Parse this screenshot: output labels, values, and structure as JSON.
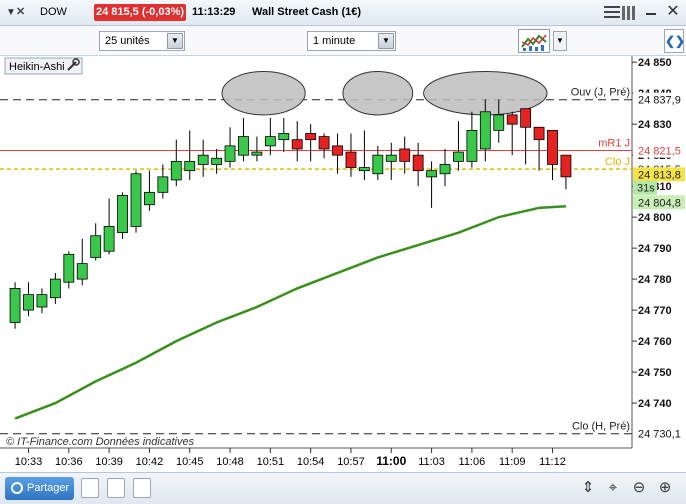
{
  "titlebar": {
    "symbol": "DOW",
    "price_change": "24 815,5 (-0,03%)",
    "time": "11:13:29",
    "instrument": "Wall Street Cash (1€)"
  },
  "toolbar": {
    "units_select": "25 unités",
    "period_select": "1 minute"
  },
  "footer": {
    "share_label": "Partager"
  },
  "colors": {
    "bull": "#3ac84a",
    "bear": "#e52222",
    "ma": "#3a8f1e",
    "mr1_line": "#e04040",
    "clo_line": "#d4c000"
  },
  "chart_data": {
    "type": "candlestick",
    "chart_style_label": "Heikin-Ashi",
    "watermark": "© IT-Finance.com  Données indicatives",
    "ylim": [
      24725.5,
      24852
    ],
    "x_tick_labels": [
      "10:33",
      "10:36",
      "10:39",
      "10:42",
      "10:45",
      "10:48",
      "10:51",
      "10:54",
      "10:57",
      "11:00",
      "11:03",
      "11:06",
      "11:09",
      "11:12"
    ],
    "x_tick_minutes": [
      633,
      636,
      639,
      642,
      645,
      648,
      651,
      654,
      657,
      660,
      663,
      666,
      669,
      672
    ],
    "y_ticks": [
      24740,
      24750,
      24760,
      24770,
      24780,
      24790,
      24800,
      24810,
      24820,
      24830,
      24840,
      24850
    ],
    "y_tick_labels": [
      "24 740",
      "24 750",
      "24 760",
      "24 770",
      "24 780",
      "24 790",
      "24 800",
      "24 810",
      "24 820",
      "24 830",
      "24 840",
      "24 850"
    ],
    "series": [
      {
        "name": "Heikin-Ashi",
        "time_minutes": [
          632,
          633,
          634,
          635,
          636,
          637,
          638,
          639,
          640,
          641,
          642,
          643,
          644,
          645,
          646,
          647,
          648,
          649,
          650,
          651,
          652,
          653,
          654,
          655,
          656,
          657,
          658,
          659,
          660,
          661,
          662,
          663,
          664,
          665,
          666,
          667,
          668,
          669,
          670,
          671,
          672,
          673
        ],
        "open": [
          24766,
          24770,
          24771,
          24774,
          24779,
          24780,
          24787,
          24789,
          24795,
          24797,
          24804,
          24808,
          24812,
          24815,
          24817,
          24817,
          24818,
          24820,
          24820,
          24823,
          24825,
          24825,
          24827,
          24826,
          24823,
          24821,
          24815,
          24814,
          24818,
          24822,
          24820,
          24813,
          24814,
          24818,
          24818,
          24822,
          24828,
          24833,
          24835,
          24829,
          24828,
          24820
        ],
        "close": [
          24777,
          24775,
          24775,
          24780,
          24788,
          24785,
          24794,
          24797,
          24807,
          24814,
          24808,
          24813,
          24818,
          24818,
          24820,
          24819,
          24823,
          24826,
          24821,
          24826,
          24827,
          24822,
          24825,
          24822,
          24820,
          24816,
          24816,
          24820,
          24820,
          24818,
          24815,
          24815,
          24817,
          24821,
          24828,
          24834,
          24833,
          24830,
          24829,
          24825,
          24817,
          24813
        ],
        "high": [
          24779,
          24779,
          24777,
          24782,
          24789,
          24793,
          24798,
          24806,
          24808,
          24815,
          24815,
          24817,
          24825,
          24828,
          24825,
          24822,
          24829,
          24832,
          24826,
          24832,
          24832,
          24831,
          24830,
          24827,
          24827,
          24827,
          24828,
          24823,
          24824,
          24826,
          24824,
          24818,
          24822,
          24831,
          24834,
          24838,
          24838,
          24834,
          24832,
          24828,
          24827,
          24817
        ],
        "low": [
          24764,
          24768,
          24769,
          24772,
          24777,
          24778,
          24786,
          24788,
          24793,
          24795,
          24802,
          24806,
          24810,
          24812,
          24813,
          24814,
          24816,
          24818,
          24818,
          24820,
          24821,
          24818,
          24818,
          24819,
          24814,
          24813,
          24812,
          24812,
          24812,
          24814,
          24810,
          24803,
          24810,
          24815,
          24816,
          24818,
          24824,
          24820,
          24817,
          24815,
          24812,
          24809
        ]
      },
      {
        "name": "moving average",
        "time_minutes": [
          632,
          635,
          638,
          641,
          644,
          647,
          650,
          653,
          656,
          659,
          662,
          665,
          668,
          671,
          673
        ],
        "values": [
          24735,
          24740,
          24747,
          24753,
          24760,
          24766,
          24771,
          24777,
          24782,
          24787,
          24791,
          24795,
          24800,
          24803,
          24803.5
        ]
      }
    ],
    "annotations": [
      {
        "id": "ouv",
        "label": "Ouv (J, Pré)",
        "value": 24837.9,
        "value_label": "24 837,9",
        "style": "dashed-black"
      },
      {
        "id": "mr1",
        "label": "mR1 J",
        "value": 24821.5,
        "value_label": "24 821,5",
        "style": "solid-red"
      },
      {
        "id": "clo",
        "label": "Clo J",
        "value": 24815.5,
        "value_label": "24 815,5",
        "style": "dashed-yellow"
      },
      {
        "id": "last",
        "label": "",
        "value": 24813.8,
        "value_label": "24 813,8",
        "style": "marker-yellow"
      },
      {
        "id": "countdown",
        "label": "31s",
        "value": 24809.5,
        "value_label": "",
        "style": "marker-green"
      },
      {
        "id": "ma_last",
        "label": "",
        "value": 24804.8,
        "value_label": "24 804,8",
        "style": "marker-green"
      },
      {
        "id": "cloH",
        "label": "Clo (H, Pré)",
        "value": 24730.1,
        "value_label": "24 730,1",
        "style": "dashed-black"
      }
    ],
    "highlight_ellipses_minutes": [
      [
        648,
        653
      ],
      [
        657,
        661
      ],
      [
        663,
        671
      ]
    ]
  }
}
